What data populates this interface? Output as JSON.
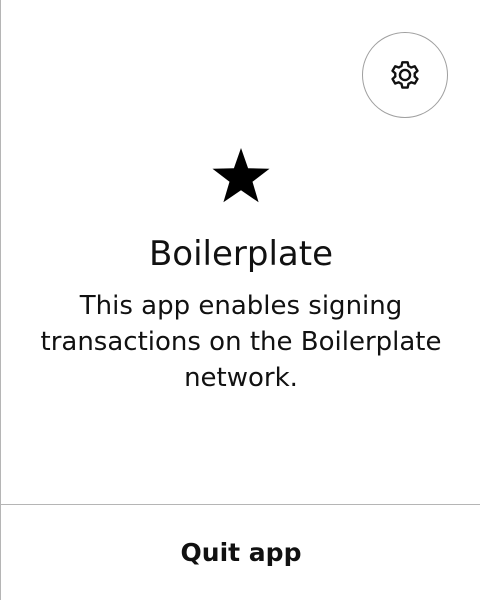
{
  "header": {
    "settings_icon": "gear-icon"
  },
  "app": {
    "icon": "star-icon",
    "name": "Boilerplate",
    "description": "This app enables signing transactions on the Boilerplate network."
  },
  "footer": {
    "quit_label": "Quit app"
  },
  "colors": {
    "text": "#111111",
    "background": "#ffffff",
    "border": "#b5b5b5"
  }
}
